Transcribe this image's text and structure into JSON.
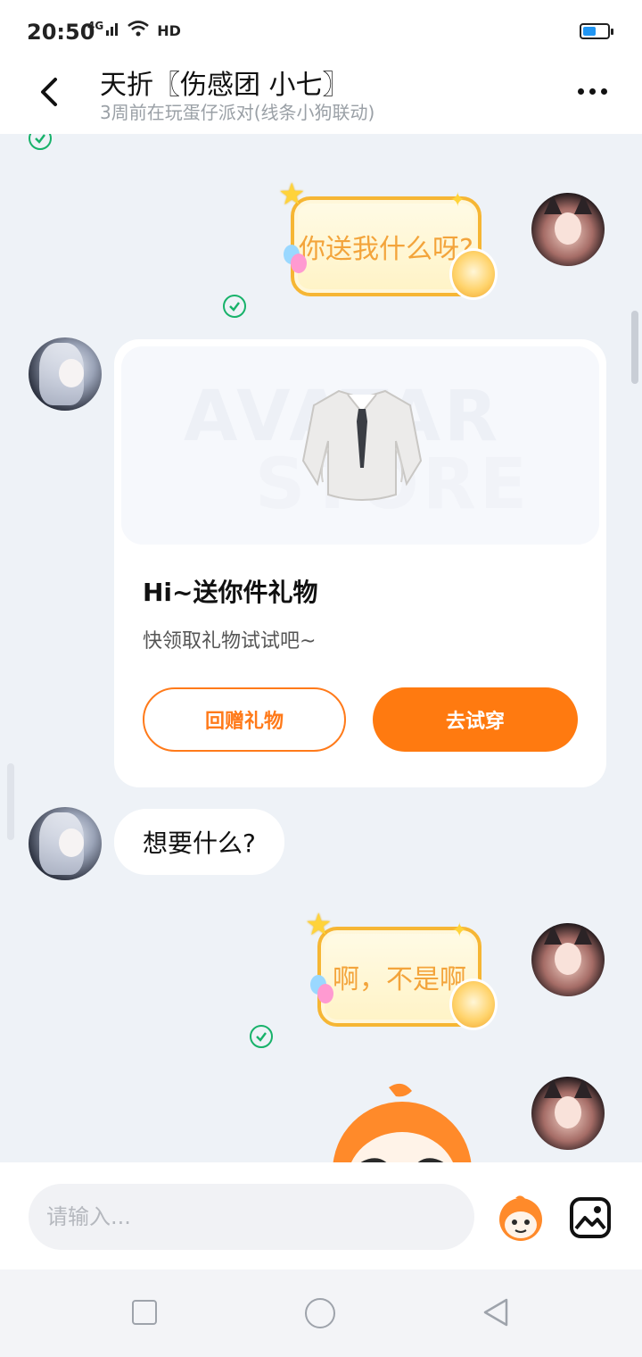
{
  "status_bar": {
    "time": "20:50",
    "network": "4G",
    "wifi_icon": "wifi-icon",
    "hd_label": "HD",
    "battery_level": 0.55
  },
  "header": {
    "title": "天折〖伤感团  小七〗",
    "subtitle": "3周前在玩蛋仔派对(线条小狗联动)"
  },
  "messages": {
    "sent_1": "你送我什么呀?",
    "gift": {
      "watermark_line1": "AVATAR",
      "watermark_line2": "STORE",
      "title": "Hi~送你件礼物",
      "description": "快领取礼物试试吧~",
      "return_button": "回赠礼物",
      "try_button": "去试穿"
    },
    "received_1": "想要什么?",
    "sent_2": "啊，不是啊"
  },
  "input": {
    "placeholder": "请输入..."
  },
  "colors": {
    "accent": "#ff7a10",
    "check_green": "#17b26a",
    "sticker_text": "#f3a43b"
  }
}
